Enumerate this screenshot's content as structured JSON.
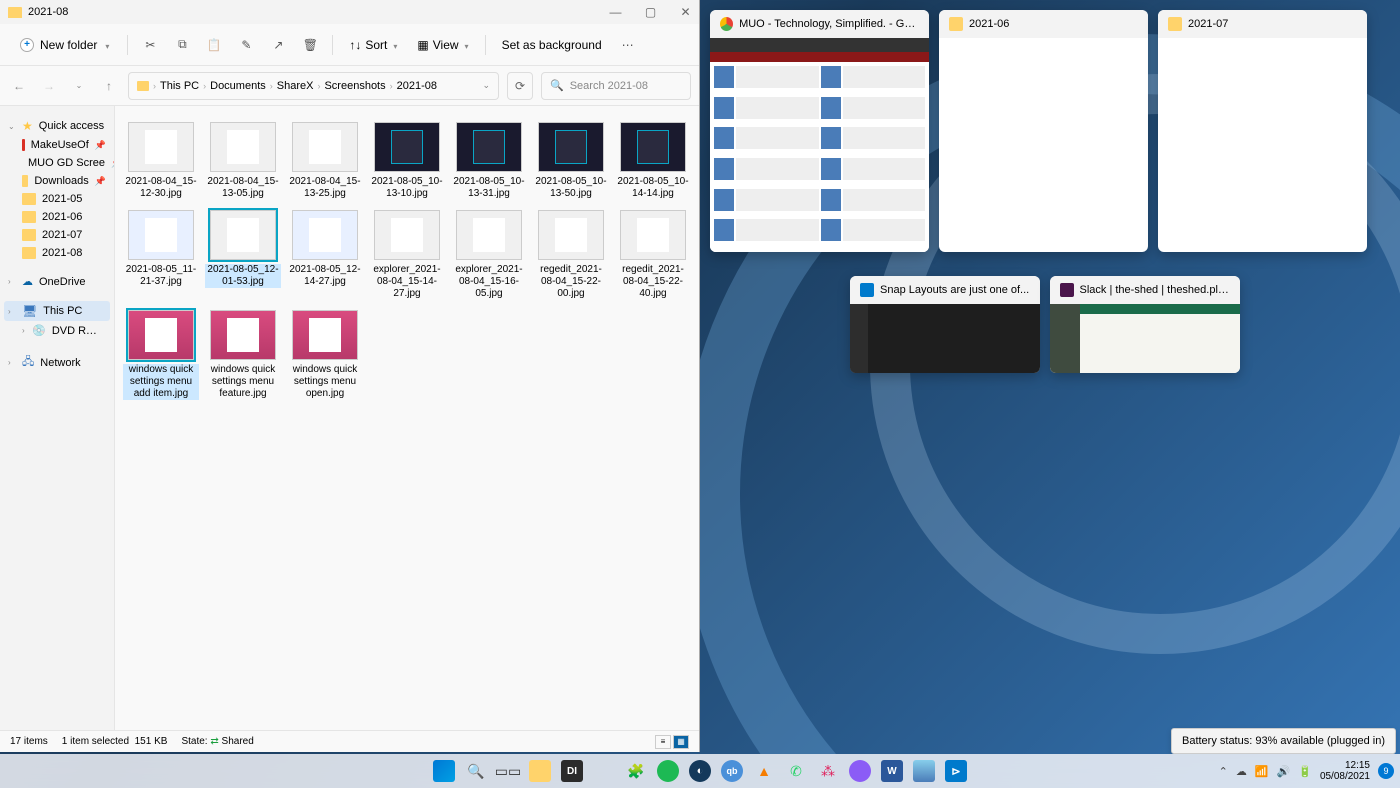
{
  "explorer": {
    "title": "2021-08",
    "toolbar": {
      "new_folder": "New folder",
      "sort": "Sort",
      "view": "View",
      "set_bg": "Set as background"
    },
    "breadcrumb": [
      "This PC",
      "Documents",
      "ShareX",
      "Screenshots",
      "2021-08"
    ],
    "search_placeholder": "Search 2021-08",
    "sidebar": {
      "quick_access": "Quick access",
      "quick_items": [
        {
          "label": "MakeUseOf",
          "pinned": true,
          "icon": "red"
        },
        {
          "label": "MUO GD Scree",
          "pinned": true,
          "icon": "folder"
        },
        {
          "label": "Downloads",
          "pinned": true,
          "icon": "folder"
        },
        {
          "label": "2021-05",
          "pinned": false,
          "icon": "folder"
        },
        {
          "label": "2021-06",
          "pinned": false,
          "icon": "folder"
        },
        {
          "label": "2021-07",
          "pinned": false,
          "icon": "folder"
        },
        {
          "label": "2021-08",
          "pinned": false,
          "icon": "folder"
        }
      ],
      "onedrive": "OneDrive",
      "this_pc": "This PC",
      "dvd": "DVD RW Drive (D:) A",
      "network": "Network"
    },
    "files": [
      {
        "name": "2021-08-04_15-12-30.jpg",
        "thumb": "light",
        "sel": false
      },
      {
        "name": "2021-08-04_15-13-05.jpg",
        "thumb": "light",
        "sel": false
      },
      {
        "name": "2021-08-04_15-13-25.jpg",
        "thumb": "light",
        "sel": false
      },
      {
        "name": "2021-08-05_10-13-10.jpg",
        "thumb": "dark",
        "sel": false
      },
      {
        "name": "2021-08-05_10-13-31.jpg",
        "thumb": "dark",
        "sel": false
      },
      {
        "name": "2021-08-05_10-13-50.jpg",
        "thumb": "dark",
        "sel": false
      },
      {
        "name": "2021-08-05_10-14-14.jpg",
        "thumb": "dark",
        "sel": false
      },
      {
        "name": "2021-08-05_11-21-37.jpg",
        "thumb": "blue",
        "sel": false
      },
      {
        "name": "2021-08-05_12-01-53.jpg",
        "thumb": "light",
        "sel": true
      },
      {
        "name": "2021-08-05_12-14-27.jpg",
        "thumb": "blue",
        "sel": false
      },
      {
        "name": "explorer_2021-08-04_15-14-27.jpg",
        "thumb": "light",
        "sel": false
      },
      {
        "name": "explorer_2021-08-04_15-16-05.jpg",
        "thumb": "light",
        "sel": false
      },
      {
        "name": "regedit_2021-08-04_15-22-00.jpg",
        "thumb": "light",
        "sel": false
      },
      {
        "name": "regedit_2021-08-04_15-22-40.jpg",
        "thumb": "light",
        "sel": false
      },
      {
        "name": "windows quick settings menu add item.jpg",
        "thumb": "pink",
        "sel": true
      },
      {
        "name": "windows quick settings menu feature.jpg",
        "thumb": "pink",
        "sel": false
      },
      {
        "name": "windows quick settings menu open.jpg",
        "thumb": "pink",
        "sel": false
      }
    ],
    "status": {
      "items": "17 items",
      "selected": "1 item selected",
      "size": "151 KB",
      "state_label": "State:",
      "state_value": "Shared"
    }
  },
  "snap": {
    "thumbs_row1": [
      {
        "title": "MUO - Technology, Simplified. - Goog...",
        "icon": "chrome",
        "kind": "chrome"
      },
      {
        "title": "2021-06",
        "icon": "folder",
        "kind": "explorer"
      },
      {
        "title": "2021-07",
        "icon": "folder",
        "kind": "explorer"
      }
    ],
    "thumbs_row2": [
      {
        "title": "Snap Layouts are just one of...",
        "icon": "vscode",
        "kind": "vscode"
      },
      {
        "title": "Slack | the-shed | theshed.place",
        "icon": "slack",
        "kind": "slack"
      }
    ]
  },
  "tooltip": "Battery status: 93% available (plugged in)",
  "taskbar": {
    "time": "12:15",
    "date": "05/08/2021",
    "notif_count": "9"
  }
}
